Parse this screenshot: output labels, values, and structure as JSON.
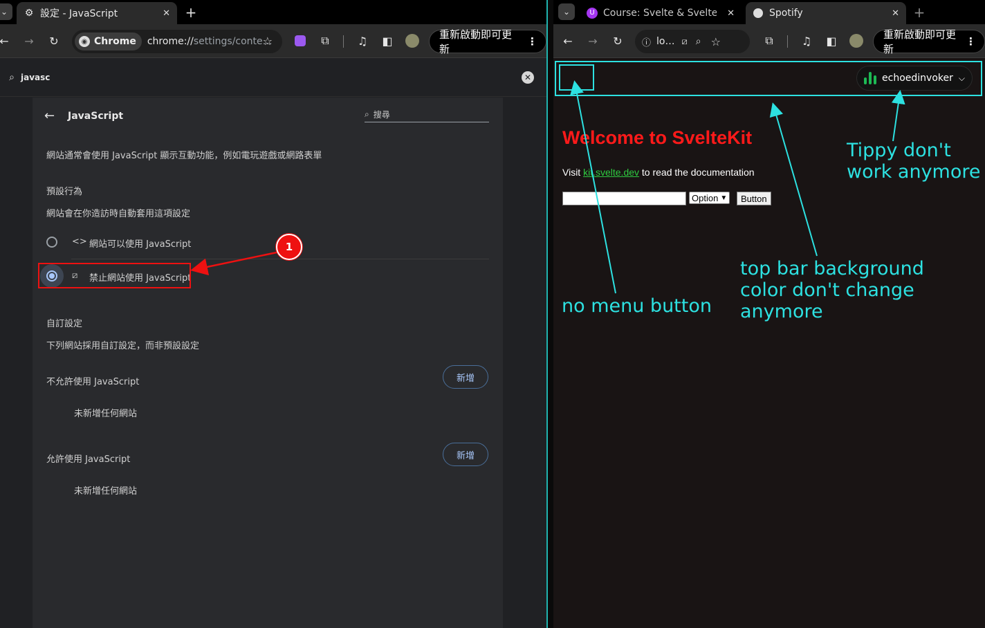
{
  "left_window": {
    "tabs": [
      {
        "icon": "gear-icon",
        "title": "設定 - JavaScript",
        "close": "✕"
      }
    ],
    "new_tab": "+",
    "chip_label": "Chrome",
    "url_scheme": "chrome://",
    "url_rest": "settings/conte…",
    "update_button": "重新啟動即可更新",
    "search_query": "javasc",
    "settings": {
      "page_title": "JavaScript",
      "search_placeholder": "搜尋",
      "description": "網站通常會使用 JavaScript 顯示互動功能，例如電玩遊戲或網路表單",
      "default_heading": "預設行為",
      "default_sub": "網站會在你造訪時自動套用這項設定",
      "option_allow": "網站可以使用 JavaScript",
      "option_block": "禁止網站使用 JavaScript",
      "selected_option": "block",
      "custom_heading": "自訂設定",
      "custom_sub": "下列網站採用自訂設定，而非預設設定",
      "not_allowed_label": "不允許使用 JavaScript",
      "allowed_label": "允許使用 JavaScript",
      "add_button": "新增",
      "empty_text": "未新增任何網站"
    },
    "callout_number": "1"
  },
  "right_window": {
    "tabs": [
      {
        "icon": "udemy-icon",
        "title": "Course: Svelte & SvelteKit",
        "close": "✕"
      },
      {
        "icon": "page-icon",
        "title": "Spotify",
        "close": "✕"
      }
    ],
    "new_tab": "+",
    "url_text": "lo…",
    "update_button": "重新啟動即可更新",
    "app": {
      "username": "echoedinvoker",
      "heading": "Welcome to SvelteKit",
      "visit_prefix": "Visit ",
      "visit_link": "kit.svelte.dev",
      "visit_suffix": " to read the documentation",
      "select_value": "Option",
      "button_label": "Button"
    },
    "annotations": {
      "tippy_line1": "Tippy don't",
      "tippy_line2": "work anymore",
      "topbar_line1": "top bar background",
      "topbar_line2": "color don't change",
      "topbar_line3": "anymore",
      "menu_note": "no menu button"
    }
  },
  "colors": {
    "annotation": "#2de1e1",
    "callout_red": "#ee1111",
    "svelte_heading": "#ff1a1a",
    "link_green": "#2ecc40",
    "spotify_green": "#1db954",
    "settings_accent": "#a8c7fa"
  }
}
